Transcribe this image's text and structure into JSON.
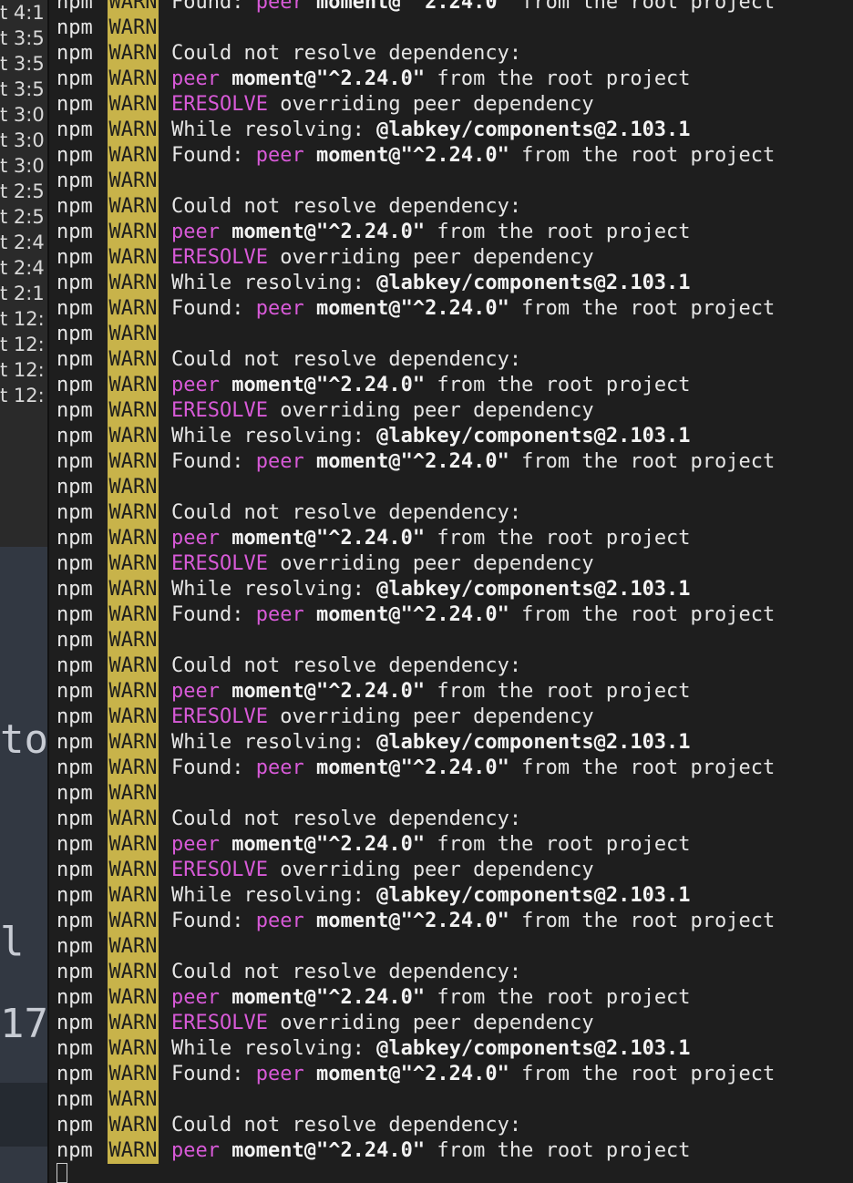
{
  "left_pane": {
    "rows": [
      "t 4:1",
      "t 3:5",
      "t 3:5",
      "t 3:5",
      "t 3:0",
      "t 3:0",
      "t 3:0",
      "t 2:5",
      "t 2:5",
      "t 2:4",
      "t 2:4",
      "t 2:1",
      "t 12:",
      "t 12:",
      "t 12:",
      "t 12:"
    ],
    "editor_fragments": [
      "to",
      "l",
      "17"
    ]
  },
  "terminal": {
    "prefix": "npm",
    "level": "WARN",
    "lines": [
      {
        "type": "found"
      },
      {
        "type": "blank"
      },
      {
        "type": "could"
      },
      {
        "type": "peer"
      },
      {
        "type": "eresolve"
      },
      {
        "type": "while"
      },
      {
        "type": "found"
      },
      {
        "type": "blank"
      },
      {
        "type": "could"
      },
      {
        "type": "peer"
      },
      {
        "type": "eresolve"
      },
      {
        "type": "while"
      },
      {
        "type": "found"
      },
      {
        "type": "blank"
      },
      {
        "type": "could"
      },
      {
        "type": "peer"
      },
      {
        "type": "eresolve"
      },
      {
        "type": "while"
      },
      {
        "type": "found"
      },
      {
        "type": "blank"
      },
      {
        "type": "could"
      },
      {
        "type": "peer"
      },
      {
        "type": "eresolve"
      },
      {
        "type": "while"
      },
      {
        "type": "found"
      },
      {
        "type": "blank"
      },
      {
        "type": "could"
      },
      {
        "type": "peer"
      },
      {
        "type": "eresolve"
      },
      {
        "type": "while"
      },
      {
        "type": "found"
      },
      {
        "type": "blank"
      },
      {
        "type": "could"
      },
      {
        "type": "peer"
      },
      {
        "type": "eresolve"
      },
      {
        "type": "while"
      },
      {
        "type": "found"
      },
      {
        "type": "blank"
      },
      {
        "type": "could"
      },
      {
        "type": "peer"
      },
      {
        "type": "eresolve"
      },
      {
        "type": "while"
      },
      {
        "type": "found"
      },
      {
        "type": "blank"
      },
      {
        "type": "could"
      },
      {
        "type": "peer"
      }
    ],
    "text": {
      "could": "Could not resolve dependency:",
      "peer_kw": "peer",
      "pkg": "moment@\"^2.24.0\"",
      "from_root": " from the root project",
      "eresolve_kw": "ERESOLVE",
      "eresolve_rest": " overriding peer dependency",
      "while_label": "While resolving: ",
      "while_pkg": "@labkey/components@2.103.1",
      "found_label": "Found: "
    },
    "colors": {
      "warn_bg": "#c8b34a",
      "keyword": "#d85ad8",
      "text": "#e6e6e6"
    }
  }
}
